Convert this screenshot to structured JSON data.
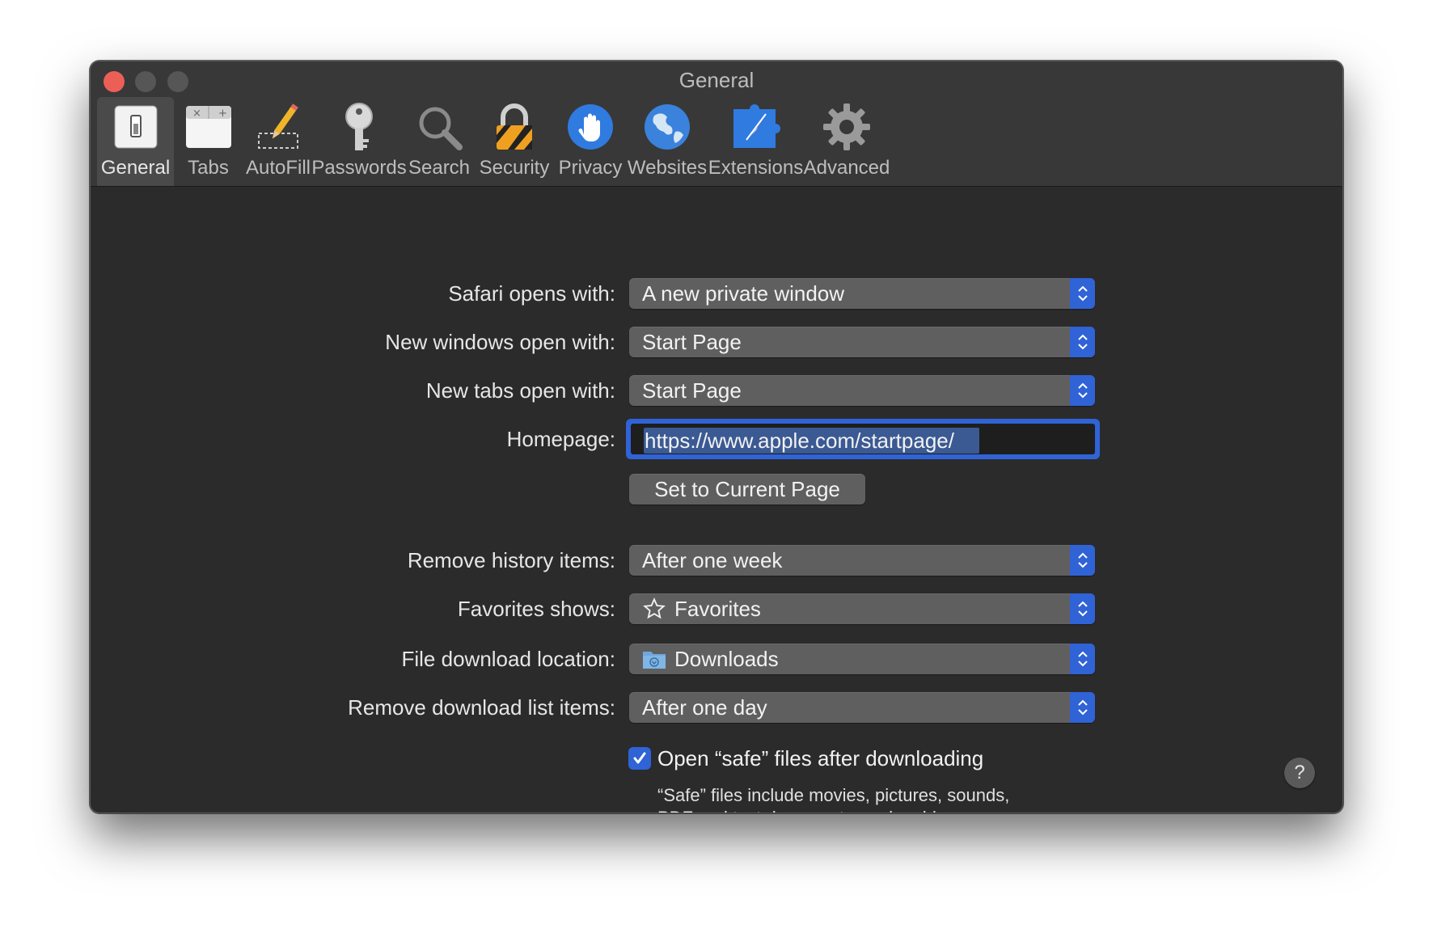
{
  "window": {
    "title": "General"
  },
  "toolbar": {
    "items": [
      {
        "label": "General",
        "icon": "general-switch-icon",
        "selected": true
      },
      {
        "label": "Tabs",
        "icon": "tabs-icon"
      },
      {
        "label": "AutoFill",
        "icon": "pencil-icon"
      },
      {
        "label": "Passwords",
        "icon": "key-icon"
      },
      {
        "label": "Search",
        "icon": "magnifying-glass-icon"
      },
      {
        "label": "Security",
        "icon": "padlock-icon"
      },
      {
        "label": "Privacy",
        "icon": "hand-icon"
      },
      {
        "label": "Websites",
        "icon": "globe-icon"
      },
      {
        "label": "Extensions",
        "icon": "puzzle-compass-icon"
      },
      {
        "label": "Advanced",
        "icon": "gear-icon"
      }
    ]
  },
  "general": {
    "safari_opens_with": {
      "label": "Safari opens with:",
      "value": "A new private window"
    },
    "new_windows": {
      "label": "New windows open with:",
      "value": "Start Page"
    },
    "new_tabs": {
      "label": "New tabs open with:",
      "value": "Start Page"
    },
    "homepage": {
      "label": "Homepage:",
      "value": "https://www.apple.com/startpage/"
    },
    "set_current_button": "Set to Current Page",
    "remove_history": {
      "label": "Remove history items:",
      "value": "After one week"
    },
    "favorites_shows": {
      "label": "Favorites shows:",
      "value": "Favorites"
    },
    "download_location": {
      "label": "File download location:",
      "value": "Downloads"
    },
    "remove_download": {
      "label": "Remove download list items:",
      "value": "After one day"
    },
    "open_safe": {
      "label": "Open “safe” files after downloading",
      "checked": true,
      "note": "“Safe” files include movies, pictures, sounds, PDF and text documents, and archives."
    },
    "help_symbol": "?"
  },
  "colors": {
    "accent": "#2f63d6",
    "window_bg": "#2b2b2b",
    "close": "#ec5f57"
  }
}
